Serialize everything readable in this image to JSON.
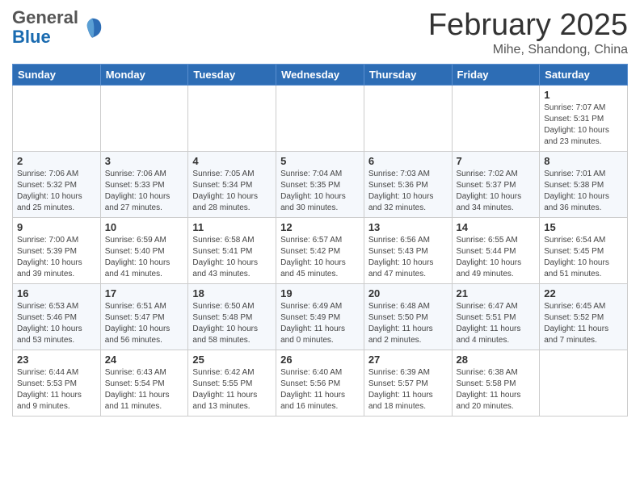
{
  "header": {
    "logo": {
      "general": "General",
      "blue": "Blue"
    },
    "title": "February 2025",
    "location": "Mihe, Shandong, China"
  },
  "days_of_week": [
    "Sunday",
    "Monday",
    "Tuesday",
    "Wednesday",
    "Thursday",
    "Friday",
    "Saturday"
  ],
  "weeks": [
    [
      {
        "day": "",
        "info": ""
      },
      {
        "day": "",
        "info": ""
      },
      {
        "day": "",
        "info": ""
      },
      {
        "day": "",
        "info": ""
      },
      {
        "day": "",
        "info": ""
      },
      {
        "day": "",
        "info": ""
      },
      {
        "day": "1",
        "info": "Sunrise: 7:07 AM\nSunset: 5:31 PM\nDaylight: 10 hours and 23 minutes."
      }
    ],
    [
      {
        "day": "2",
        "info": "Sunrise: 7:06 AM\nSunset: 5:32 PM\nDaylight: 10 hours and 25 minutes."
      },
      {
        "day": "3",
        "info": "Sunrise: 7:06 AM\nSunset: 5:33 PM\nDaylight: 10 hours and 27 minutes."
      },
      {
        "day": "4",
        "info": "Sunrise: 7:05 AM\nSunset: 5:34 PM\nDaylight: 10 hours and 28 minutes."
      },
      {
        "day": "5",
        "info": "Sunrise: 7:04 AM\nSunset: 5:35 PM\nDaylight: 10 hours and 30 minutes."
      },
      {
        "day": "6",
        "info": "Sunrise: 7:03 AM\nSunset: 5:36 PM\nDaylight: 10 hours and 32 minutes."
      },
      {
        "day": "7",
        "info": "Sunrise: 7:02 AM\nSunset: 5:37 PM\nDaylight: 10 hours and 34 minutes."
      },
      {
        "day": "8",
        "info": "Sunrise: 7:01 AM\nSunset: 5:38 PM\nDaylight: 10 hours and 36 minutes."
      }
    ],
    [
      {
        "day": "9",
        "info": "Sunrise: 7:00 AM\nSunset: 5:39 PM\nDaylight: 10 hours and 39 minutes."
      },
      {
        "day": "10",
        "info": "Sunrise: 6:59 AM\nSunset: 5:40 PM\nDaylight: 10 hours and 41 minutes."
      },
      {
        "day": "11",
        "info": "Sunrise: 6:58 AM\nSunset: 5:41 PM\nDaylight: 10 hours and 43 minutes."
      },
      {
        "day": "12",
        "info": "Sunrise: 6:57 AM\nSunset: 5:42 PM\nDaylight: 10 hours and 45 minutes."
      },
      {
        "day": "13",
        "info": "Sunrise: 6:56 AM\nSunset: 5:43 PM\nDaylight: 10 hours and 47 minutes."
      },
      {
        "day": "14",
        "info": "Sunrise: 6:55 AM\nSunset: 5:44 PM\nDaylight: 10 hours and 49 minutes."
      },
      {
        "day": "15",
        "info": "Sunrise: 6:54 AM\nSunset: 5:45 PM\nDaylight: 10 hours and 51 minutes."
      }
    ],
    [
      {
        "day": "16",
        "info": "Sunrise: 6:53 AM\nSunset: 5:46 PM\nDaylight: 10 hours and 53 minutes."
      },
      {
        "day": "17",
        "info": "Sunrise: 6:51 AM\nSunset: 5:47 PM\nDaylight: 10 hours and 56 minutes."
      },
      {
        "day": "18",
        "info": "Sunrise: 6:50 AM\nSunset: 5:48 PM\nDaylight: 10 hours and 58 minutes."
      },
      {
        "day": "19",
        "info": "Sunrise: 6:49 AM\nSunset: 5:49 PM\nDaylight: 11 hours and 0 minutes."
      },
      {
        "day": "20",
        "info": "Sunrise: 6:48 AM\nSunset: 5:50 PM\nDaylight: 11 hours and 2 minutes."
      },
      {
        "day": "21",
        "info": "Sunrise: 6:47 AM\nSunset: 5:51 PM\nDaylight: 11 hours and 4 minutes."
      },
      {
        "day": "22",
        "info": "Sunrise: 6:45 AM\nSunset: 5:52 PM\nDaylight: 11 hours and 7 minutes."
      }
    ],
    [
      {
        "day": "23",
        "info": "Sunrise: 6:44 AM\nSunset: 5:53 PM\nDaylight: 11 hours and 9 minutes."
      },
      {
        "day": "24",
        "info": "Sunrise: 6:43 AM\nSunset: 5:54 PM\nDaylight: 11 hours and 11 minutes."
      },
      {
        "day": "25",
        "info": "Sunrise: 6:42 AM\nSunset: 5:55 PM\nDaylight: 11 hours and 13 minutes."
      },
      {
        "day": "26",
        "info": "Sunrise: 6:40 AM\nSunset: 5:56 PM\nDaylight: 11 hours and 16 minutes."
      },
      {
        "day": "27",
        "info": "Sunrise: 6:39 AM\nSunset: 5:57 PM\nDaylight: 11 hours and 18 minutes."
      },
      {
        "day": "28",
        "info": "Sunrise: 6:38 AM\nSunset: 5:58 PM\nDaylight: 11 hours and 20 minutes."
      },
      {
        "day": "",
        "info": ""
      }
    ]
  ]
}
